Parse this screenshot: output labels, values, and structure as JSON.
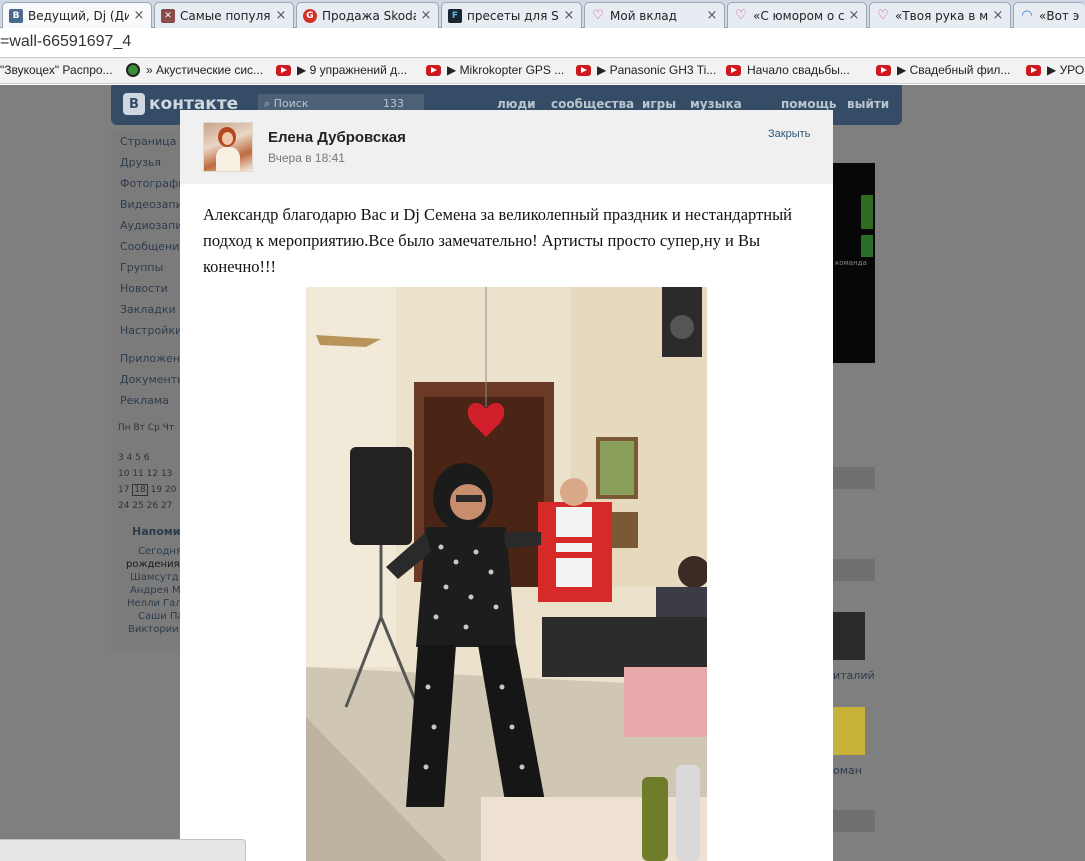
{
  "browser": {
    "tabs": [
      {
        "title": "Ведущий, Dj (Ди",
        "favicon": "vk-icon",
        "active": true
      },
      {
        "title": "Самые популяр",
        "favicon": "image-icon",
        "active": false
      },
      {
        "title": "Продажа Skoda",
        "favicon": "auto-site-icon",
        "active": false
      },
      {
        "title": "пресеты для Spi",
        "favicon": "f-icon",
        "active": false
      },
      {
        "title": "Мой вклад",
        "favicon": "heart-icon",
        "active": false
      },
      {
        "title": "«С юмором о се",
        "favicon": "heart-icon",
        "active": false
      },
      {
        "title": "«Твоя рука в мо",
        "favicon": "heart-icon",
        "active": false
      },
      {
        "title": "«Вот это",
        "favicon": "loading-icon",
        "active": false
      }
    ],
    "url": "=wall-66591697_4",
    "bookmarks": [
      {
        "label": "\"Звукоцех\" Распро...",
        "icon": "none"
      },
      {
        "label": "» Акустические сис...",
        "icon": "globe-icon"
      },
      {
        "label": "▶ 9 упражнений д...",
        "icon": "youtube-icon"
      },
      {
        "label": "▶ Mikrokopter GPS ...",
        "icon": "youtube-icon"
      },
      {
        "label": "▶ Panasonic GH3 Ti...",
        "icon": "youtube-icon"
      },
      {
        "label": "Начало свадьбы...",
        "icon": "youtube-icon"
      },
      {
        "label": "▶ Свадебный фил...",
        "icon": "youtube-icon"
      },
      {
        "label": "▶ УРОК",
        "icon": "youtube-icon"
      }
    ]
  },
  "vk": {
    "logo_letter": "В",
    "logo_text": "контакте",
    "search_placeholder": "Поиск",
    "search_count": "133",
    "nav": [
      "люди",
      "сообщества",
      "игры",
      "музыка",
      "помощь",
      "выйти"
    ],
    "sidebar": [
      "Страница",
      "Друзья",
      "Фотографи",
      "Видеозапис",
      "Аудиозапис",
      "Сообщения",
      "Группы",
      "Новости",
      "Закладки",
      "Настройки",
      "Приложени",
      "Документы",
      "Реклама"
    ],
    "calendar": {
      "weekdays": "Пн Вт Ср Чт",
      "rows": [
        "3  4  5  6",
        "10  11  12  13",
        "17  18  19  20",
        "24  25  26  27"
      ],
      "today": "18"
    },
    "reminder": {
      "title": "Напоми",
      "lines": [
        "Сегодня",
        "рождения",
        "Шамсутд",
        "Андрея М",
        "Нелли Гал",
        "Саши Па",
        "Виктории"
      ]
    },
    "ad_text": "команда",
    "friends": [
      "италий",
      "оман"
    ]
  },
  "post": {
    "author": "Елена Дубровская",
    "time": "Вчера в 18:41",
    "close_label": "Закрыть",
    "text": "Александр благодарю Вас и Dj Семена за великолепный праздник и нестандартный подход к мероприятию.Все было замечательно! Артисты просто супер,ну и Вы конечно!!!"
  },
  "colors": {
    "vk_header": "#344c66",
    "link": "#2b587a",
    "overlay_page": "#7f7f7f"
  }
}
